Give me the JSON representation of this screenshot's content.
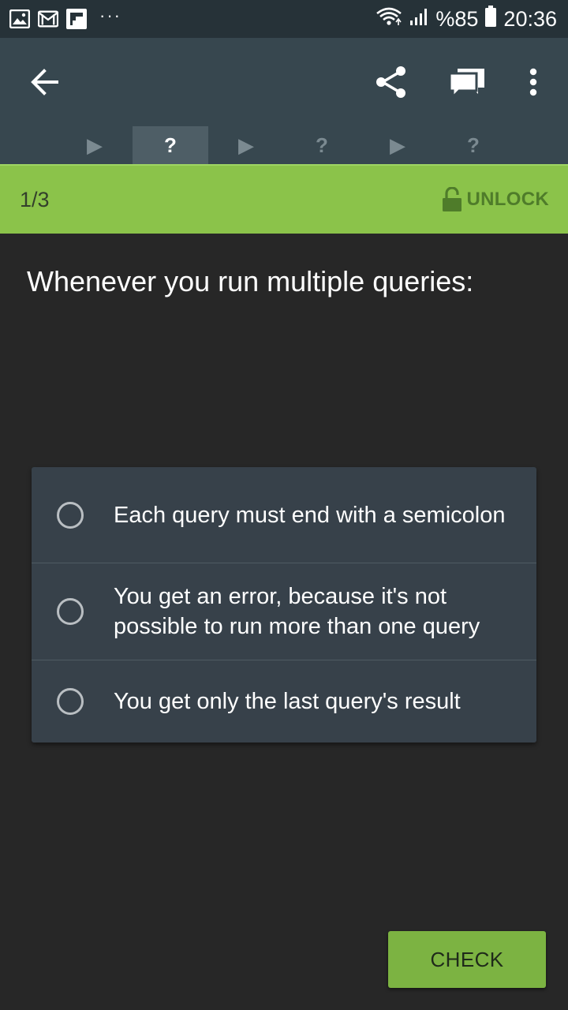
{
  "status_bar": {
    "left_icons": [
      "gallery-icon",
      "gmail-icon",
      "flipboard-icon"
    ],
    "more_notifications": "···",
    "right_icons": [
      "wifi-icon",
      "signal-icon",
      "battery-icon"
    ],
    "battery_percent": "%85",
    "time": "20:36"
  },
  "app_bar": {
    "icons": [
      "back-arrow-icon",
      "share-icon",
      "chat-icon",
      "more-vertical-icon"
    ]
  },
  "steps": [
    {
      "type": "play",
      "label": "▶",
      "active": false
    },
    {
      "type": "question",
      "label": "?",
      "active": true
    },
    {
      "type": "play",
      "label": "▶",
      "active": false
    },
    {
      "type": "question",
      "label": "?",
      "active": false
    },
    {
      "type": "play",
      "label": "▶",
      "active": false
    },
    {
      "type": "question",
      "label": "?",
      "active": false
    }
  ],
  "progress": {
    "count": "1/3",
    "unlock_label": "UNLOCK"
  },
  "question": {
    "text": "Whenever you run multiple queries:"
  },
  "options": [
    {
      "label": "Each query must end with a semicolon",
      "selected": false
    },
    {
      "label": "You get an error, because it's not possible to run more than one query",
      "selected": false
    },
    {
      "label": "You get only the last query's result",
      "selected": false
    }
  ],
  "actions": {
    "check_label": "CHECK"
  },
  "colors": {
    "status_bar": "#263238",
    "app_bar": "#37474F",
    "accent_green": "#8BC34A",
    "button_green": "#7CB342",
    "background": "#272727",
    "card": "#37414A"
  }
}
